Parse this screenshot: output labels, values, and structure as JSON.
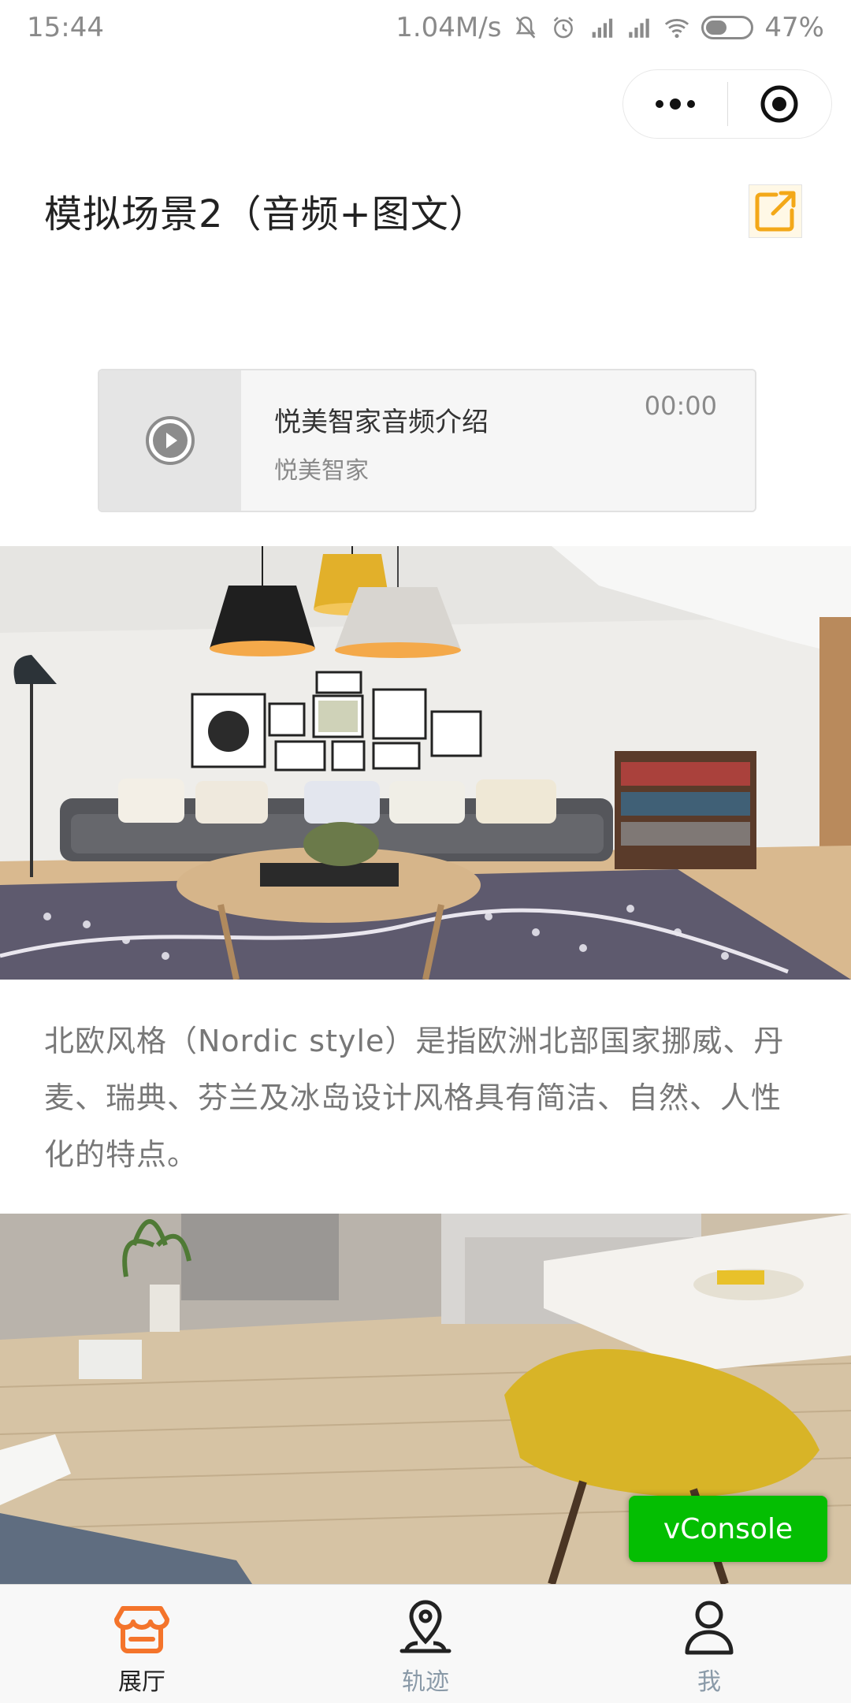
{
  "status_bar": {
    "time": "15:44",
    "net_speed": "1.04M/s",
    "battery_percent": "47%",
    "battery_level": 0.47
  },
  "capsule": {
    "more_icon": "more-dots-icon",
    "close_icon": "target-icon"
  },
  "page": {
    "title": "模拟场景2（音频+图文）",
    "share_icon": "share-external-icon"
  },
  "audio": {
    "name": "悦美智家音频介绍",
    "author": "悦美智家",
    "time": "00:00",
    "play_icon": "play-icon"
  },
  "article": {
    "paragraph": "北欧风格（Nordic style）是指欧洲北部国家挪威、丹麦、瑞典、芬兰及冰岛设计风格具有简洁、自然、人性化的特点。"
  },
  "vconsole": {
    "label": "vConsole",
    "color": "#04be02"
  },
  "tabbar": {
    "active_color": "#f4742b",
    "items": [
      {
        "label": "展厅",
        "icon": "store-icon",
        "active": true
      },
      {
        "label": "轨迹",
        "icon": "location-pin-icon",
        "active": false
      },
      {
        "label": "我",
        "icon": "user-icon",
        "active": false
      }
    ]
  }
}
